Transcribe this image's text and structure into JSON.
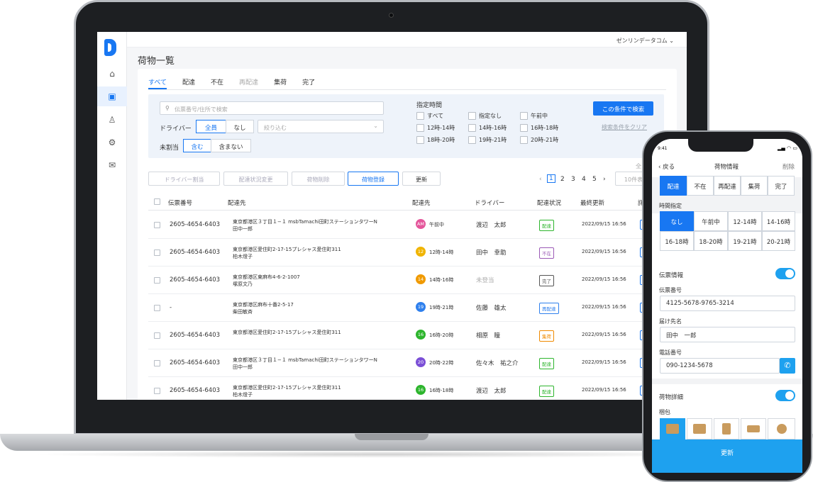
{
  "app": {
    "account": "ゼンリンデータコム",
    "page_title": "荷物一覧"
  },
  "nav": [
    "home-icon",
    "package-icon",
    "users-icon",
    "settings-icon",
    "mail-icon"
  ],
  "tabs": [
    "すべて",
    "配達",
    "不在",
    "再配達",
    "集荷",
    "完了"
  ],
  "filter": {
    "search_placeholder": "伝票番号/住所で検索",
    "driver_label": "ドライバー",
    "driver_all": "全員",
    "driver_none": "なし",
    "narrow_placeholder": "絞り込む",
    "unassigned_label": "未割当",
    "include": "含む",
    "exclude": "含まない",
    "time_label": "指定時間",
    "time_options": [
      "すべて",
      "指定なし",
      "午前中",
      "12時-14時",
      "14時-16時",
      "16時-18時",
      "18時-20時",
      "19時-21時",
      "20時-21時"
    ],
    "search_button": "この条件で検索",
    "clear_link": "検索条件をクリア"
  },
  "toolbar": {
    "assign": "ドライバー割当",
    "status_change": "配達状況変更",
    "delete": "荷物削除",
    "register": "荷物登録",
    "refresh": "更新",
    "pages": [
      "1",
      "2",
      "3",
      "4",
      "5"
    ],
    "per_page": "10件表示",
    "overflow": "全"
  },
  "table": {
    "headers": [
      "伝票番号",
      "配達先",
      "配達先",
      "ドライバー",
      "配達状況",
      "最終更新",
      "詳"
    ],
    "rows": [
      {
        "no": "2605-4654-6403",
        "addr1": "東京都港区３丁目１−１ msbTamachi田町ステーションタワーN",
        "addr2": "田中一郎",
        "badge": "AM",
        "time": "午前中",
        "driver": "渡辺　太郎",
        "status": "配達",
        "updated": "2022/09/15  16:56",
        "color": "#e4569b"
      },
      {
        "no": "2605-4654-6403",
        "addr1": "東京都港区愛住町2-17-15プレシャス愛住町311",
        "addr2": "柏木燈子",
        "badge": "12",
        "time": "12時-14時",
        "driver": "田中　幸助",
        "status": "不在",
        "updated": "2022/09/15  16:56",
        "color": "#f0b400"
      },
      {
        "no": "2605-4654-6403",
        "addr1": "東京都港区東麻布4-6-2-1007",
        "addr2": "塚原文乃",
        "badge": "14",
        "time": "14時-16時",
        "driver": "未登当",
        "status": "完了",
        "updated": "2022/09/15  16:56",
        "color": "#f09a00"
      },
      {
        "no": "-",
        "addr1": "東京都港区麻布十番2-5-17",
        "addr2": "柴田敏斉",
        "badge": "19",
        "time": "19時-21時",
        "driver": "佐藤　雄太",
        "status": "再配達",
        "updated": "2022/09/15  16:56",
        "color": "#2f80ed"
      },
      {
        "no": "2605-4654-6403",
        "addr1": "東京都港区愛住町2-17-15プレシャス愛住町311",
        "addr2": "",
        "badge": "16",
        "time": "16時-20時",
        "driver": "相原　瞳",
        "status": "集荷",
        "updated": "2022/09/15  16:56",
        "color": "#2db52d"
      },
      {
        "no": "2605-4654-6403",
        "addr1": "東京都港区３丁目１−１ msbTamachi田町ステーションタワーN",
        "addr2": "田中一郎",
        "badge": "20",
        "time": "20時-22時",
        "driver": "佐々木　祐之介",
        "status": "配達",
        "updated": "2022/09/15  16:56",
        "color": "#7b4fd6"
      },
      {
        "no": "2605-4654-6403",
        "addr1": "東京都港区愛住町2-17-15プレシャス愛住町311",
        "addr2": "柏木燈子",
        "badge": "16",
        "time": "16時-18時",
        "driver": "渡辺　太郎",
        "status": "配達",
        "updated": "2022/09/15  16:56",
        "color": "#2db52d"
      }
    ]
  },
  "status_colors": {
    "配達": "#2db52d",
    "不在": "#9b59b6",
    "完了": "#555555",
    "再配達": "#2f80ed",
    "集荷": "#f08a00"
  },
  "phone": {
    "time": "9:41",
    "back": "戻る",
    "title": "荷物情報",
    "delete": "削除",
    "status_tabs": [
      "配達",
      "不在",
      "再配達",
      "集荷",
      "完了"
    ],
    "time_label": "時間指定",
    "time_slots": [
      "なし",
      "午前中",
      "12-14時",
      "14-16時",
      "16-18時",
      "18-20時",
      "19-21時",
      "20-21時"
    ],
    "slip_section": "伝票情報",
    "slip_label": "伝票番号",
    "slip_value": "4125-5678-9765-3214",
    "name_label": "届け先名",
    "name_value": "田中　一郎",
    "phone_label": "電話番号",
    "phone_value": "090-1234-5678",
    "detail_section": "荷物詳細",
    "pack_label": "梱包",
    "update_button": "更新"
  }
}
